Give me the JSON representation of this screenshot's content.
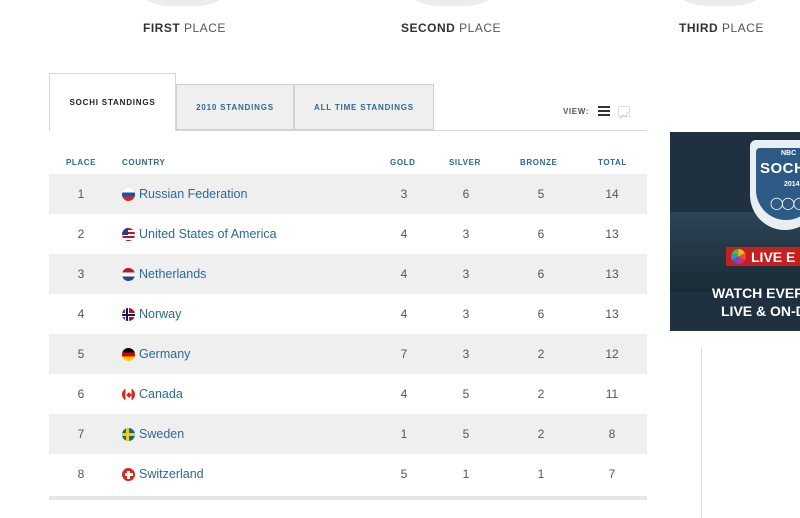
{
  "medals": {
    "first": {
      "bold": "FIRST",
      "rest": " PLACE"
    },
    "second": {
      "bold": "SECOND",
      "rest": " PLACE"
    },
    "third": {
      "bold": "THIRD",
      "rest": " PLACE"
    }
  },
  "tabs": [
    {
      "label": "SOCHI STANDINGS"
    },
    {
      "label": "2010 STANDINGS"
    },
    {
      "label": "ALL TIME STANDINGS"
    }
  ],
  "view_label": "VIEW:",
  "columns": {
    "place": "PLACE",
    "country": "COUNTRY",
    "gold": "GOLD",
    "silver": "SILVER",
    "bronze": "BRONZE",
    "total": "TOTAL"
  },
  "rows": [
    {
      "place": "1",
      "country": "Russian Federation",
      "gold": "3",
      "silver": "6",
      "bronze": "5",
      "total": "14"
    },
    {
      "place": "2",
      "country": "United States of America",
      "gold": "4",
      "silver": "3",
      "bronze": "6",
      "total": "13"
    },
    {
      "place": "3",
      "country": "Netherlands",
      "gold": "4",
      "silver": "3",
      "bronze": "6",
      "total": "13"
    },
    {
      "place": "4",
      "country": "Norway",
      "gold": "4",
      "silver": "3",
      "bronze": "6",
      "total": "13"
    },
    {
      "place": "5",
      "country": "Germany",
      "gold": "7",
      "silver": "3",
      "bronze": "2",
      "total": "12"
    },
    {
      "place": "6",
      "country": "Canada",
      "gold": "4",
      "silver": "5",
      "bronze": "2",
      "total": "11"
    },
    {
      "place": "7",
      "country": "Sweden",
      "gold": "1",
      "silver": "5",
      "bronze": "2",
      "total": "8"
    },
    {
      "place": "8",
      "country": "Switzerland",
      "gold": "5",
      "silver": "1",
      "bronze": "1",
      "total": "7"
    }
  ],
  "ad": {
    "brand_top": "NBC",
    "brand": "SOCH",
    "year": "2014",
    "live": "LIVE E",
    "line1": "WATCH EVERY",
    "line2": "LIVE & ON-D"
  },
  "colors": {
    "link": "#2b6a94",
    "row_alt": "#efefef",
    "ad_bg": "#1f3140",
    "live_red": "#c81e1e"
  }
}
